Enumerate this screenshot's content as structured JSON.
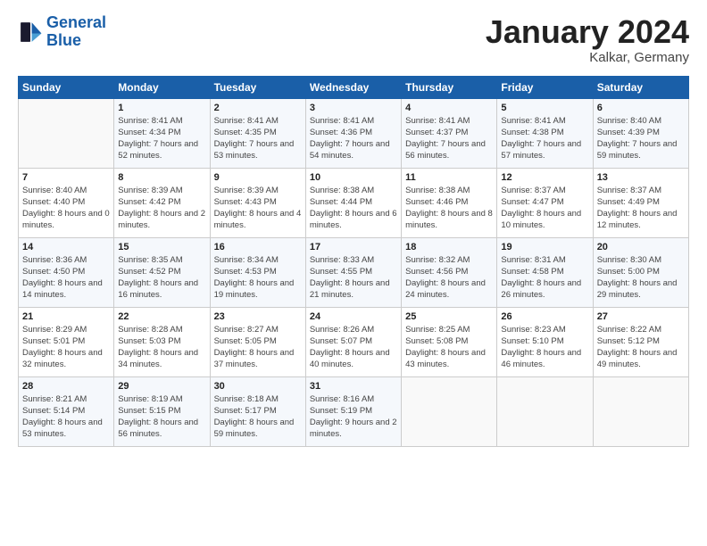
{
  "header": {
    "logo_line1": "General",
    "logo_line2": "Blue",
    "month": "January 2024",
    "location": "Kalkar, Germany"
  },
  "days_of_week": [
    "Sunday",
    "Monday",
    "Tuesday",
    "Wednesday",
    "Thursday",
    "Friday",
    "Saturday"
  ],
  "weeks": [
    [
      {
        "day": "",
        "sunrise": "",
        "sunset": "",
        "daylight": ""
      },
      {
        "day": "1",
        "sunrise": "Sunrise: 8:41 AM",
        "sunset": "Sunset: 4:34 PM",
        "daylight": "Daylight: 7 hours and 52 minutes."
      },
      {
        "day": "2",
        "sunrise": "Sunrise: 8:41 AM",
        "sunset": "Sunset: 4:35 PM",
        "daylight": "Daylight: 7 hours and 53 minutes."
      },
      {
        "day": "3",
        "sunrise": "Sunrise: 8:41 AM",
        "sunset": "Sunset: 4:36 PM",
        "daylight": "Daylight: 7 hours and 54 minutes."
      },
      {
        "day": "4",
        "sunrise": "Sunrise: 8:41 AM",
        "sunset": "Sunset: 4:37 PM",
        "daylight": "Daylight: 7 hours and 56 minutes."
      },
      {
        "day": "5",
        "sunrise": "Sunrise: 8:41 AM",
        "sunset": "Sunset: 4:38 PM",
        "daylight": "Daylight: 7 hours and 57 minutes."
      },
      {
        "day": "6",
        "sunrise": "Sunrise: 8:40 AM",
        "sunset": "Sunset: 4:39 PM",
        "daylight": "Daylight: 7 hours and 59 minutes."
      }
    ],
    [
      {
        "day": "7",
        "sunrise": "Sunrise: 8:40 AM",
        "sunset": "Sunset: 4:40 PM",
        "daylight": "Daylight: 8 hours and 0 minutes."
      },
      {
        "day": "8",
        "sunrise": "Sunrise: 8:39 AM",
        "sunset": "Sunset: 4:42 PM",
        "daylight": "Daylight: 8 hours and 2 minutes."
      },
      {
        "day": "9",
        "sunrise": "Sunrise: 8:39 AM",
        "sunset": "Sunset: 4:43 PM",
        "daylight": "Daylight: 8 hours and 4 minutes."
      },
      {
        "day": "10",
        "sunrise": "Sunrise: 8:38 AM",
        "sunset": "Sunset: 4:44 PM",
        "daylight": "Daylight: 8 hours and 6 minutes."
      },
      {
        "day": "11",
        "sunrise": "Sunrise: 8:38 AM",
        "sunset": "Sunset: 4:46 PM",
        "daylight": "Daylight: 8 hours and 8 minutes."
      },
      {
        "day": "12",
        "sunrise": "Sunrise: 8:37 AM",
        "sunset": "Sunset: 4:47 PM",
        "daylight": "Daylight: 8 hours and 10 minutes."
      },
      {
        "day": "13",
        "sunrise": "Sunrise: 8:37 AM",
        "sunset": "Sunset: 4:49 PM",
        "daylight": "Daylight: 8 hours and 12 minutes."
      }
    ],
    [
      {
        "day": "14",
        "sunrise": "Sunrise: 8:36 AM",
        "sunset": "Sunset: 4:50 PM",
        "daylight": "Daylight: 8 hours and 14 minutes."
      },
      {
        "day": "15",
        "sunrise": "Sunrise: 8:35 AM",
        "sunset": "Sunset: 4:52 PM",
        "daylight": "Daylight: 8 hours and 16 minutes."
      },
      {
        "day": "16",
        "sunrise": "Sunrise: 8:34 AM",
        "sunset": "Sunset: 4:53 PM",
        "daylight": "Daylight: 8 hours and 19 minutes."
      },
      {
        "day": "17",
        "sunrise": "Sunrise: 8:33 AM",
        "sunset": "Sunset: 4:55 PM",
        "daylight": "Daylight: 8 hours and 21 minutes."
      },
      {
        "day": "18",
        "sunrise": "Sunrise: 8:32 AM",
        "sunset": "Sunset: 4:56 PM",
        "daylight": "Daylight: 8 hours and 24 minutes."
      },
      {
        "day": "19",
        "sunrise": "Sunrise: 8:31 AM",
        "sunset": "Sunset: 4:58 PM",
        "daylight": "Daylight: 8 hours and 26 minutes."
      },
      {
        "day": "20",
        "sunrise": "Sunrise: 8:30 AM",
        "sunset": "Sunset: 5:00 PM",
        "daylight": "Daylight: 8 hours and 29 minutes."
      }
    ],
    [
      {
        "day": "21",
        "sunrise": "Sunrise: 8:29 AM",
        "sunset": "Sunset: 5:01 PM",
        "daylight": "Daylight: 8 hours and 32 minutes."
      },
      {
        "day": "22",
        "sunrise": "Sunrise: 8:28 AM",
        "sunset": "Sunset: 5:03 PM",
        "daylight": "Daylight: 8 hours and 34 minutes."
      },
      {
        "day": "23",
        "sunrise": "Sunrise: 8:27 AM",
        "sunset": "Sunset: 5:05 PM",
        "daylight": "Daylight: 8 hours and 37 minutes."
      },
      {
        "day": "24",
        "sunrise": "Sunrise: 8:26 AM",
        "sunset": "Sunset: 5:07 PM",
        "daylight": "Daylight: 8 hours and 40 minutes."
      },
      {
        "day": "25",
        "sunrise": "Sunrise: 8:25 AM",
        "sunset": "Sunset: 5:08 PM",
        "daylight": "Daylight: 8 hours and 43 minutes."
      },
      {
        "day": "26",
        "sunrise": "Sunrise: 8:23 AM",
        "sunset": "Sunset: 5:10 PM",
        "daylight": "Daylight: 8 hours and 46 minutes."
      },
      {
        "day": "27",
        "sunrise": "Sunrise: 8:22 AM",
        "sunset": "Sunset: 5:12 PM",
        "daylight": "Daylight: 8 hours and 49 minutes."
      }
    ],
    [
      {
        "day": "28",
        "sunrise": "Sunrise: 8:21 AM",
        "sunset": "Sunset: 5:14 PM",
        "daylight": "Daylight: 8 hours and 53 minutes."
      },
      {
        "day": "29",
        "sunrise": "Sunrise: 8:19 AM",
        "sunset": "Sunset: 5:15 PM",
        "daylight": "Daylight: 8 hours and 56 minutes."
      },
      {
        "day": "30",
        "sunrise": "Sunrise: 8:18 AM",
        "sunset": "Sunset: 5:17 PM",
        "daylight": "Daylight: 8 hours and 59 minutes."
      },
      {
        "day": "31",
        "sunrise": "Sunrise: 8:16 AM",
        "sunset": "Sunset: 5:19 PM",
        "daylight": "Daylight: 9 hours and 2 minutes."
      },
      {
        "day": "",
        "sunrise": "",
        "sunset": "",
        "daylight": ""
      },
      {
        "day": "",
        "sunrise": "",
        "sunset": "",
        "daylight": ""
      },
      {
        "day": "",
        "sunrise": "",
        "sunset": "",
        "daylight": ""
      }
    ]
  ]
}
